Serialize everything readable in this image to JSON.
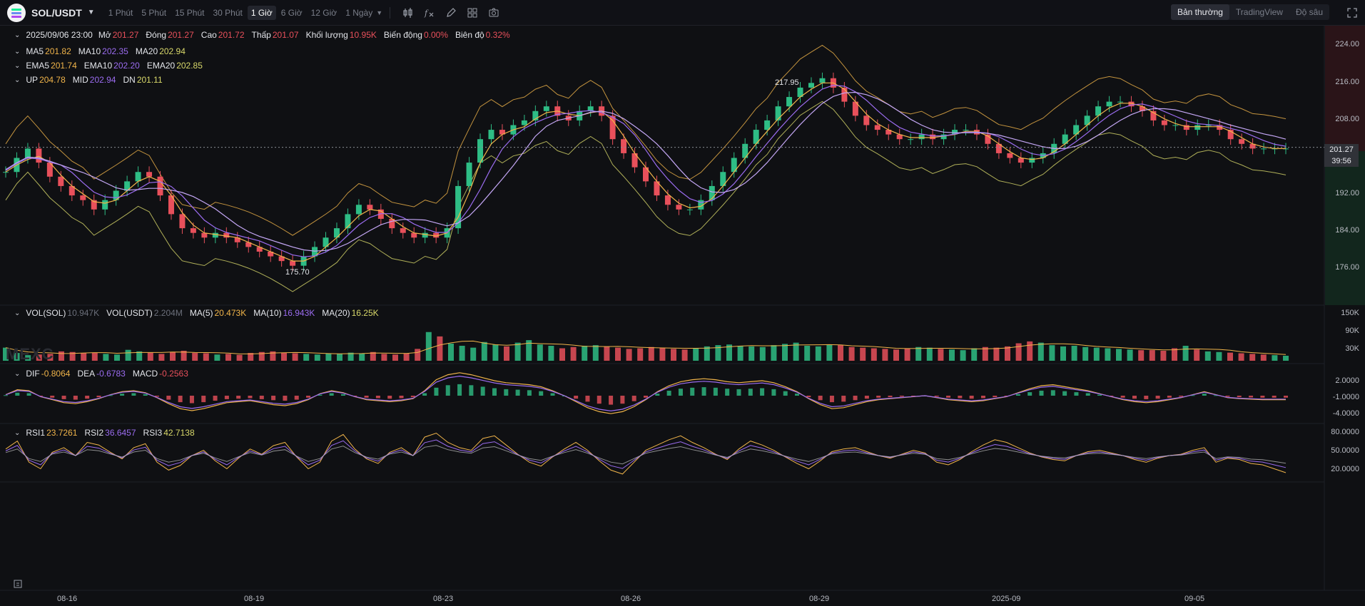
{
  "header": {
    "symbol": "SOL/USDT",
    "timeframes": [
      {
        "label": "1 Phút",
        "active": false
      },
      {
        "label": "5 Phút",
        "active": false
      },
      {
        "label": "15 Phút",
        "active": false
      },
      {
        "label": "30 Phút",
        "active": false
      },
      {
        "label": "1 Giờ",
        "active": true
      },
      {
        "label": "6 Giờ",
        "active": false
      },
      {
        "label": "12 Giờ",
        "active": false
      },
      {
        "label": "1 Ngày",
        "active": false
      }
    ],
    "tools": [
      "candle-type-icon",
      "indicator-icon",
      "draw-icon",
      "layout-icon",
      "camera-icon"
    ],
    "views": [
      {
        "label": "Bản thường",
        "active": true
      },
      {
        "label": "TradingView",
        "active": false
      },
      {
        "label": "Độ sâu",
        "active": false
      }
    ]
  },
  "ohlc": {
    "date": "2025/09/06 23:00",
    "open_label": "Mở",
    "open": "201.27",
    "close_label": "Đóng",
    "close": "201.27",
    "high_label": "Cao",
    "high": "201.72",
    "low_label": "Thấp",
    "low": "201.07",
    "volume_label": "Khối lượng",
    "volume": "10.95K",
    "change_label": "Biến động",
    "change": "0.00%",
    "amplitude_label": "Biên độ",
    "amplitude": "0.32%"
  },
  "ma": {
    "ma5_label": "MA5",
    "ma5": "201.82",
    "ma10_label": "MA10",
    "ma10": "202.35",
    "ma20_label": "MA20",
    "ma20": "202.94"
  },
  "ema": {
    "ema5_label": "EMA5",
    "ema5": "201.74",
    "ema10_label": "EMA10",
    "ema10": "202.20",
    "ema20_label": "EMA20",
    "ema20": "202.85"
  },
  "boll": {
    "up_label": "UP",
    "up": "204.78",
    "mid_label": "MID",
    "mid": "202.94",
    "dn_label": "DN",
    "dn": "201.11"
  },
  "vol": {
    "sol_label": "VOL(SOL)",
    "sol": "10.947K",
    "usdt_label": "VOL(USDT)",
    "usdt": "2.204M",
    "ma5_label": "MA(5)",
    "ma5": "20.473K",
    "ma10_label": "MA(10)",
    "ma10": "16.943K",
    "ma20_label": "MA(20)",
    "ma20": "16.25K"
  },
  "macd": {
    "dif_label": "DIF",
    "dif": "-0.8064",
    "dea_label": "DEA",
    "dea": "-0.6783",
    "macd_label": "MACD",
    "macd": "-0.2563"
  },
  "rsi": {
    "rsi1_label": "RSI1",
    "rsi1": "23.7261",
    "rsi2_label": "RSI2",
    "rsi2": "36.6457",
    "rsi3_label": "RSI3",
    "rsi3": "42.7138"
  },
  "annotations": {
    "high": "217.95",
    "low": "175.70"
  },
  "last_price": "201.27",
  "countdown": "39:56",
  "watermark": "MEXC",
  "colors": {
    "up": "#2ebd85",
    "down": "#e8505b",
    "ma5": "#f0b44a",
    "ma10": "#9b6cf0",
    "ma20": "#d8d86a",
    "bg": "#0f1013"
  },
  "chart_data": [
    {
      "type": "line",
      "title": "SOL/USDT 1 Giờ",
      "y_ticks": [
        "224.00",
        "216.00",
        "208.00",
        "200.00",
        "192.00",
        "184.00",
        "176.00"
      ],
      "y_tick_values": [
        224,
        216,
        208,
        200,
        192,
        184,
        176
      ],
      "x_ticks": [
        "08-16",
        "08-19",
        "08-23",
        "08-26",
        "08-29",
        "2025-09",
        "09-05"
      ],
      "series": [
        {
          "values": [
            196,
            199,
            201,
            198,
            195,
            193,
            191,
            190,
            188,
            190,
            192,
            194,
            196,
            195,
            191,
            187,
            184,
            183,
            182,
            183,
            182,
            181,
            180,
            179,
            178,
            177,
            176,
            178,
            180,
            182,
            184,
            187,
            189,
            188,
            186,
            184,
            183,
            182,
            183,
            182,
            184,
            193,
            198,
            203,
            205,
            204,
            206,
            207,
            209,
            210,
            208,
            207,
            209,
            210,
            208,
            203,
            200,
            197,
            194,
            191,
            189,
            188,
            188,
            190,
            193,
            196,
            199,
            202,
            205,
            207,
            210,
            212,
            214,
            215,
            216,
            214,
            211,
            208,
            206,
            205,
            204,
            203,
            203,
            204,
            203,
            204,
            205,
            205,
            204,
            202,
            200,
            199,
            198,
            199,
            200,
            202,
            204,
            206,
            208,
            210,
            211,
            211,
            210,
            209,
            207,
            206,
            206,
            205,
            206,
            206,
            205,
            203,
            202,
            201,
            201,
            201,
            201
          ]
        }
      ],
      "ylim": [
        172,
        226
      ]
    },
    {
      "type": "bar",
      "title": "VOL(SOL)",
      "y_ticks": [
        "150K",
        "90K",
        "30K"
      ],
      "y_tick_values": [
        150,
        90,
        30
      ],
      "values": [
        42,
        25,
        18,
        20,
        22,
        30,
        28,
        24,
        26,
        22,
        20,
        35,
        30,
        26,
        22,
        28,
        32,
        25,
        24,
        20,
        22,
        19,
        25,
        28,
        30,
        26,
        24,
        22,
        20,
        24,
        22,
        26,
        24,
        28,
        22,
        20,
        24,
        38,
        92,
        78,
        55,
        48,
        42,
        60,
        52,
        46,
        58,
        66,
        52,
        48,
        40,
        44,
        48,
        50,
        46,
        42,
        38,
        40,
        44,
        42,
        38,
        36,
        40,
        46,
        50,
        52,
        48,
        46,
        44,
        50,
        54,
        58,
        48,
        46,
        52,
        50,
        44,
        42,
        40,
        38,
        36,
        40,
        44,
        42,
        38,
        36,
        34,
        40,
        44,
        42,
        46,
        56,
        62,
        58,
        50,
        46,
        48,
        44,
        42,
        40,
        38,
        36,
        34,
        34,
        32,
        40,
        48,
        36,
        30,
        28,
        26,
        24,
        22,
        20,
        18,
        16
      ]
    },
    {
      "type": "line",
      "title": "MACD",
      "y_ticks": [
        "2.0000",
        "-1.0000",
        "-4.0000"
      ],
      "y_tick_values": [
        2,
        -1,
        -4
      ],
      "series": [
        {
          "name": "DIF",
          "values": [
            0.2,
            1.2,
            1.0,
            -0.2,
            -0.8,
            -1.4,
            -1.6,
            -1.2,
            -0.6,
            0.2,
            0.8,
            1.0,
            0.6,
            -0.4,
            -1.6,
            -2.6,
            -3.0,
            -2.6,
            -2.0,
            -1.4,
            -1.2,
            -1.0,
            -1.4,
            -1.8,
            -2.0,
            -1.6,
            -0.8,
            0.4,
            1.0,
            0.6,
            -0.2,
            -0.8,
            -1.0,
            -1.2,
            -1.0,
            -0.6,
            1.0,
            3.2,
            4.2,
            4.6,
            4.2,
            3.6,
            3.0,
            2.6,
            2.4,
            2.2,
            1.8,
            1.0,
            0.0,
            -1.2,
            -2.4,
            -3.2,
            -3.6,
            -3.2,
            -2.2,
            -0.8,
            0.8,
            2.0,
            2.8,
            3.2,
            3.4,
            3.2,
            2.8,
            2.6,
            2.8,
            3.0,
            2.6,
            1.8,
            0.8,
            -0.6,
            -1.8,
            -2.6,
            -2.4,
            -1.8,
            -1.2,
            -0.8,
            -0.6,
            -0.4,
            -0.2,
            0.0,
            -0.4,
            -0.8,
            -1.0,
            -1.2,
            -1.0,
            -0.6,
            -0.2,
            0.6,
            1.4,
            2.0,
            2.2,
            1.8,
            1.4,
            1.0,
            0.4,
            -0.2,
            -0.8,
            -1.2,
            -1.4,
            -1.2,
            -0.8,
            -0.4,
            0.2,
            0.8,
            0.2,
            -0.4,
            -0.6,
            -0.7,
            -0.8,
            -0.8,
            -0.8
          ]
        }
      ]
    },
    {
      "type": "line",
      "title": "RSI",
      "y_ticks": [
        "80.0000",
        "50.0000",
        "20.0000"
      ],
      "y_tick_values": [
        80,
        50,
        20
      ],
      "series": [
        {
          "name": "RSI1",
          "values": [
            60,
            72,
            40,
            30,
            55,
            62,
            50,
            70,
            66,
            55,
            45,
            62,
            68,
            40,
            28,
            35,
            50,
            58,
            42,
            30,
            46,
            60,
            52,
            65,
            70,
            48,
            30,
            40,
            72,
            82,
            60,
            45,
            38,
            55,
            62,
            50,
            78,
            84,
            70,
            62,
            58,
            76,
            80,
            66,
            52,
            40,
            34,
            48,
            60,
            70,
            58,
            42,
            28,
            22,
            40,
            58,
            66,
            74,
            80,
            70,
            62,
            52,
            44,
            60,
            72,
            66,
            58,
            48,
            38,
            30,
            42,
            56,
            60,
            62,
            56,
            50,
            46,
            52,
            58,
            54,
            40,
            36,
            44,
            56,
            66,
            74,
            70,
            62,
            54,
            48,
            44,
            42,
            50,
            56,
            58,
            54,
            50,
            44,
            40,
            46,
            50,
            52,
            58,
            62,
            40,
            46,
            44,
            38,
            36,
            30,
            24
          ]
        }
      ]
    }
  ]
}
